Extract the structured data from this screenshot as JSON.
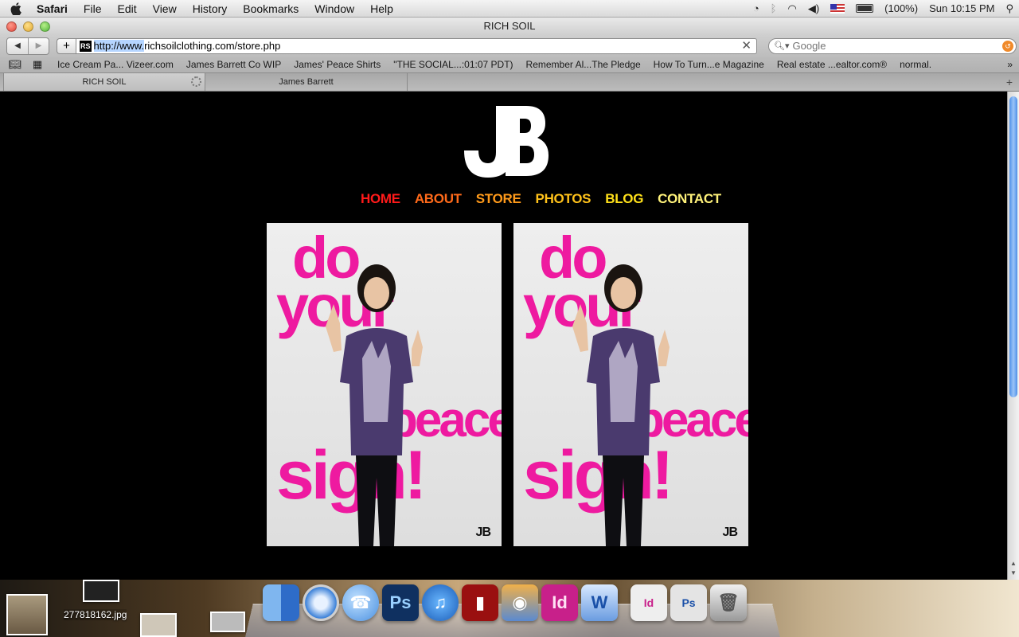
{
  "menubar": {
    "app_name": "Safari",
    "menus": [
      "File",
      "Edit",
      "View",
      "History",
      "Bookmarks",
      "Window",
      "Help"
    ],
    "battery": "(100%)",
    "clock": "Sun 10:15 PM"
  },
  "window": {
    "title": "RICH SOIL"
  },
  "toolbar": {
    "url_prefix": "http://www.",
    "url_rest": "richsoilclothing.com/store.php",
    "favicon": "RS",
    "search_placeholder": "Google"
  },
  "bookmarks": [
    "Ice Cream Pa... Vizeer.com",
    "James Barrett Co WIP",
    "James' Peace Shirts",
    "\"THE SOCIAL...:01:07 PDT)",
    "Remember Al...The Pledge",
    "How To Turn...e Magazine",
    "Real estate ...ealtor.com®",
    "normal."
  ],
  "tabs": [
    "RICH SOIL",
    "James Barrett"
  ],
  "site": {
    "logo_text": "JB",
    "nav": [
      {
        "label": "HOME",
        "color": "#ff1a1a"
      },
      {
        "label": "ABOUT",
        "color": "#ff6a1a"
      },
      {
        "label": "STORE",
        "color": "#ff9a1a"
      },
      {
        "label": "PHOTOS",
        "color": "#ffc21a"
      },
      {
        "label": "BLOG",
        "color": "#ffe01a"
      },
      {
        "label": "CONTACT",
        "color": "#fff27a"
      }
    ],
    "products": [
      {
        "l1": "do",
        "l2": "your",
        "l3": "peace",
        "l4": "sign!",
        "brand": "JB"
      },
      {
        "l1": "do",
        "l2": "your",
        "l3": "peace",
        "l4": "sign!",
        "brand": "JB"
      }
    ]
  },
  "desktop": {
    "file_label": "277818162.jpg"
  },
  "dock": {
    "apps": [
      "Finder",
      "Safari",
      "iChat",
      "Ps",
      "iTunes",
      "Photo Booth",
      "iPhoto",
      "Id",
      "Word",
      "Id",
      "Ps",
      "Trash"
    ]
  },
  "colors": {
    "accent_pink": "#ee1aa0",
    "page_bg": "#000000"
  }
}
